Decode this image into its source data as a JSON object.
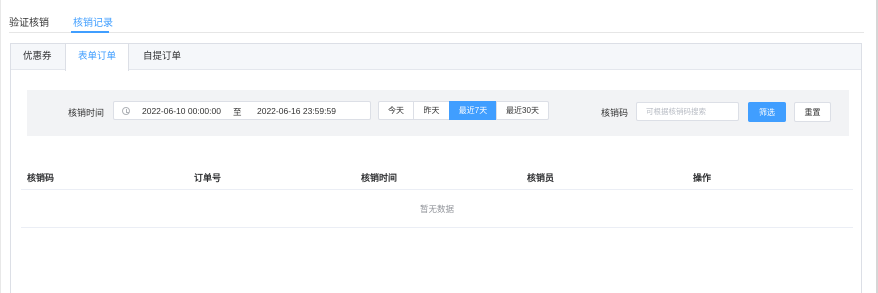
{
  "top_tabs": [
    {
      "label": "验证核销"
    },
    {
      "label": "核销记录"
    }
  ],
  "sub_tabs": [
    {
      "label": "优惠券"
    },
    {
      "label": "表单订单"
    },
    {
      "label": "自提订单"
    }
  ],
  "filter": {
    "time_label": "核销时间",
    "date_start": "2022-06-10 00:00:00",
    "date_separator": "至",
    "date_end": "2022-06-16 23:59:59",
    "quick_ranges": [
      "今天",
      "昨天",
      "最近7天",
      "最近30天"
    ],
    "active_range": "最近7天",
    "code_label": "核销码",
    "code_placeholder": "可根据核销码搜索",
    "code_value": "",
    "filter_button": "筛选",
    "reset_button": "重置"
  },
  "table": {
    "columns": [
      "核销码",
      "订单号",
      "核销时间",
      "核销员",
      "操作"
    ],
    "rows": [],
    "empty_text": "暂无数据"
  },
  "colors": {
    "accent": "#409eff",
    "filter_bg": "#f2f3f5",
    "border": "#dcdfe6"
  },
  "icons": {
    "date_prefix": "clock-icon"
  }
}
